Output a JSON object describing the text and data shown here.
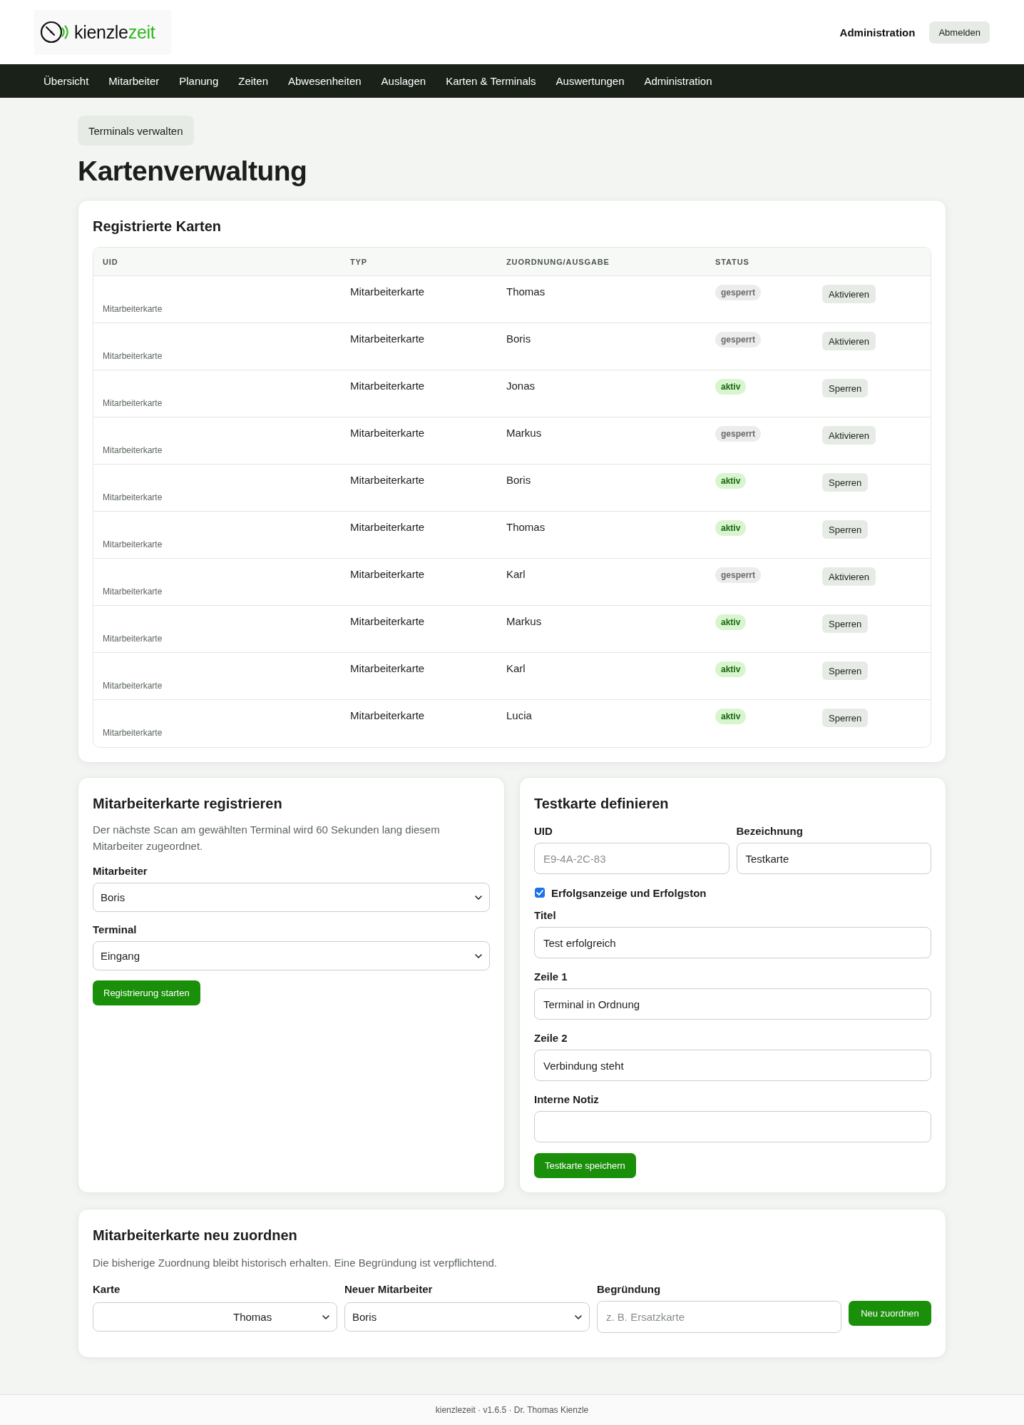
{
  "header": {
    "logo": {
      "name": "kienzle",
      "accent": "zeit"
    },
    "user_link": "Administration",
    "logout_button": "Abmelden"
  },
  "nav": {
    "items": [
      "Übersicht",
      "Mitarbeiter",
      "Planung",
      "Zeiten",
      "Abwesenheiten",
      "Auslagen",
      "Karten & Terminals",
      "Auswertungen",
      "Administration"
    ]
  },
  "toolbar_button": "Terminals verwalten",
  "page_title": "Kartenverwaltung",
  "cards_table": {
    "title": "Registrierte Karten",
    "columns": [
      "UID",
      "TYP",
      "ZUORDNUNG/AUSGABE",
      "STATUS"
    ],
    "rows": [
      {
        "uid_note": "Mitarbeiterkarte",
        "type": "Mitarbeiterkarte",
        "assignee": "Thomas",
        "status": "gesperrt",
        "kind": "locked",
        "action": "Aktivieren"
      },
      {
        "uid_note": "Mitarbeiterkarte",
        "type": "Mitarbeiterkarte",
        "assignee": "Boris",
        "status": "gesperrt",
        "kind": "locked",
        "action": "Aktivieren"
      },
      {
        "uid_note": "Mitarbeiterkarte",
        "type": "Mitarbeiterkarte",
        "assignee": "Jonas",
        "status": "aktiv",
        "kind": "active",
        "action": "Sperren"
      },
      {
        "uid_note": "Mitarbeiterkarte",
        "type": "Mitarbeiterkarte",
        "assignee": "Markus",
        "status": "gesperrt",
        "kind": "locked",
        "action": "Aktivieren"
      },
      {
        "uid_note": "Mitarbeiterkarte",
        "type": "Mitarbeiterkarte",
        "assignee": "Boris",
        "status": "aktiv",
        "kind": "active",
        "action": "Sperren"
      },
      {
        "uid_note": "Mitarbeiterkarte",
        "type": "Mitarbeiterkarte",
        "assignee": "Thomas",
        "status": "aktiv",
        "kind": "active",
        "action": "Sperren"
      },
      {
        "uid_note": "Mitarbeiterkarte",
        "type": "Mitarbeiterkarte",
        "assignee": "Karl",
        "status": "gesperrt",
        "kind": "locked",
        "action": "Aktivieren"
      },
      {
        "uid_note": "Mitarbeiterkarte",
        "type": "Mitarbeiterkarte",
        "assignee": "Markus",
        "status": "aktiv",
        "kind": "active",
        "action": "Sperren"
      },
      {
        "uid_note": "Mitarbeiterkarte",
        "type": "Mitarbeiterkarte",
        "assignee": "Karl",
        "status": "aktiv",
        "kind": "active",
        "action": "Sperren"
      },
      {
        "uid_note": "Mitarbeiterkarte",
        "type": "Mitarbeiterkarte",
        "assignee": "Lucia",
        "status": "aktiv",
        "kind": "active",
        "action": "Sperren"
      }
    ]
  },
  "register_card": {
    "title": "Mitarbeiterkarte registrieren",
    "description": "Der nächste Scan am gewählten Terminal wird 60 Sekunden lang diesem Mitarbeiter zugeordnet.",
    "selects": [
      {
        "label": "Mitarbeiter",
        "value": "Boris"
      },
      {
        "label": "Terminal",
        "value": "Eingang"
      }
    ],
    "button": "Registrierung starten"
  },
  "test_card": {
    "title": "Testkarte definieren",
    "uid": {
      "label": "UID",
      "placeholder": "E9-4A-2C-83"
    },
    "name": {
      "label": "Bezeichnung",
      "value": "Testkarte"
    },
    "success_checkbox": {
      "label": "Erfolgsanzeige und Erfolgston",
      "checked": true
    },
    "fields": [
      {
        "label": "Titel",
        "value": "Test erfolgreich"
      },
      {
        "label": "Zeile 1",
        "value": "Terminal in Ordnung"
      },
      {
        "label": "Zeile 2",
        "value": "Verbindung steht"
      },
      {
        "label": "Interne Notiz"
      }
    ],
    "button": "Testkarte speichern"
  },
  "reassign_card": {
    "title": "Mitarbeiterkarte neu zuordnen",
    "description": "Die bisherige Zuordnung bleibt historisch erhalten. Eine Begründung ist verpflichtend.",
    "card": {
      "label": "Karte",
      "value": "Thomas"
    },
    "employee": {
      "label": "Neuer Mitarbeiter",
      "value": "Boris"
    },
    "reason": {
      "label": "Begründung",
      "placeholder": "z. B. Ersatzkarte"
    },
    "button": "Neu zuordnen"
  },
  "footer": "kienzlezeit · v1.6.5 · Dr. Thomas Kienzle"
}
